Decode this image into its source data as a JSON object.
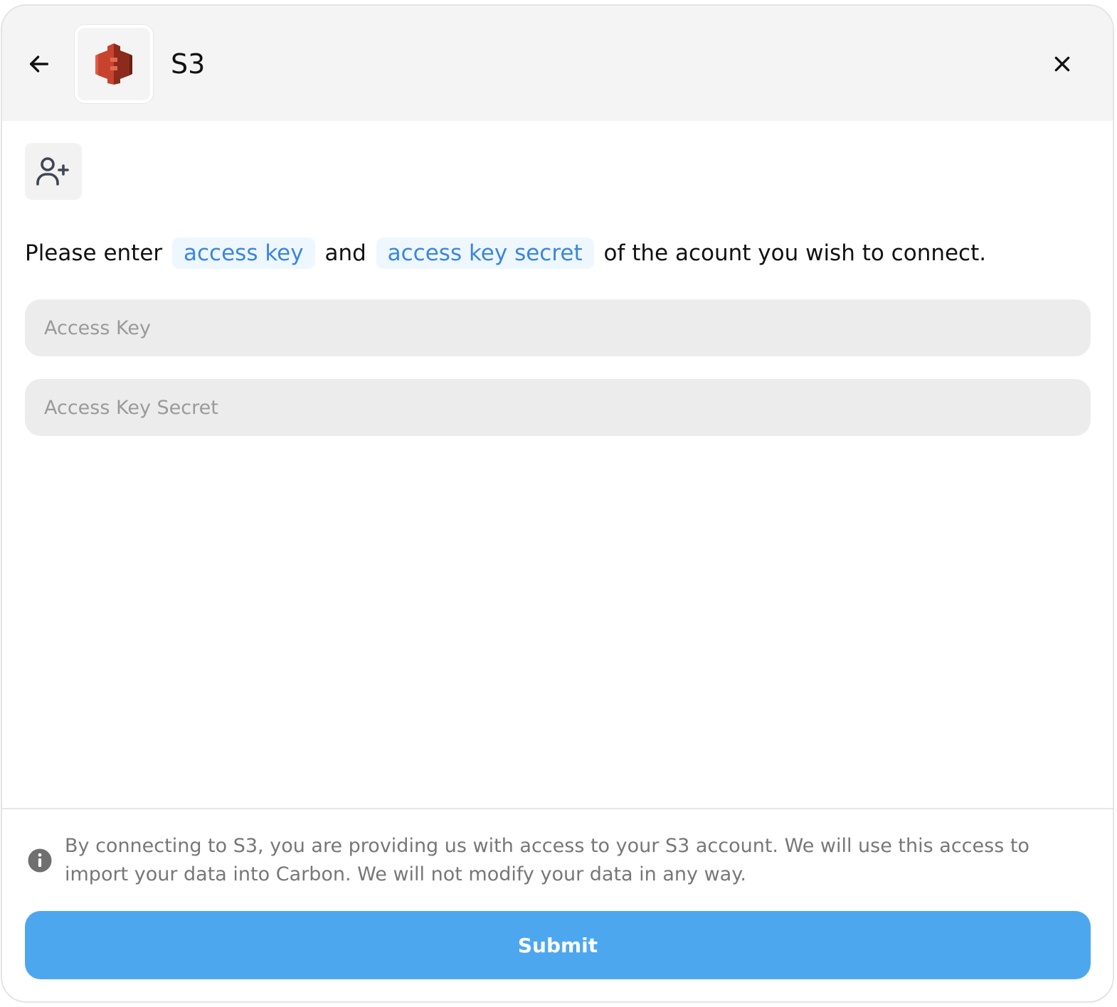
{
  "header": {
    "title": "S3",
    "back_icon": "arrow-left-icon",
    "close_icon": "close-icon",
    "logo_icon": "aws-s3-logo-icon"
  },
  "main": {
    "user_add_icon": "user-plus-icon",
    "instruction": {
      "prefix": "Please enter",
      "pill1": "access key",
      "middle": "and",
      "pill2": "access key secret",
      "suffix": "of the acount you wish to connect."
    },
    "fields": {
      "access_key": {
        "placeholder": "Access Key",
        "value": ""
      },
      "access_key_secret": {
        "placeholder": "Access Key Secret",
        "value": ""
      }
    }
  },
  "footer": {
    "info_icon": "info-icon",
    "disclaimer": "By connecting to S3, you are providing us with access to your S3 account. We will use this access to import your data into Carbon. We will not modify your data in any way.",
    "submit_label": "Submit"
  },
  "colors": {
    "accent": "#4da7ef",
    "pill_text": "#3a86e0",
    "pill_bg": "#eef7fd",
    "header_bg": "#f4f4f4",
    "s3_red": "#c7432e"
  }
}
